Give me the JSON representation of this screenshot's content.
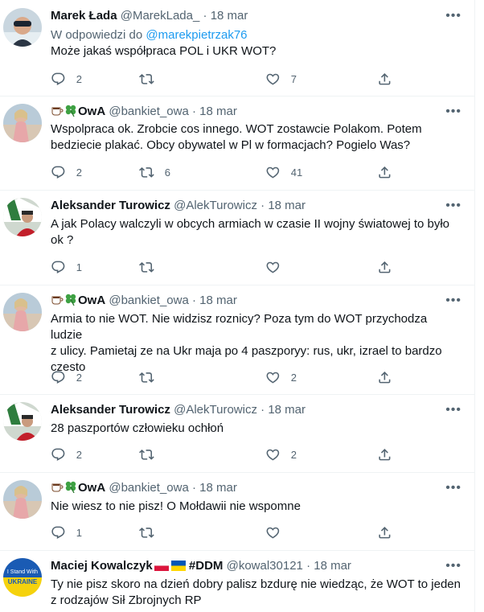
{
  "colors": {
    "link": "#1d9bf0",
    "secondary": "#536471",
    "text": "#0f1419"
  },
  "icons": {
    "reply": "reply-icon",
    "retweet": "retweet-icon",
    "like": "heart-icon",
    "share": "share-icon",
    "more": "more-options-icon"
  },
  "tweets": [
    {
      "name": "Marek Łada",
      "handle": "@MarekLada_",
      "time": "18 mar",
      "reply_prefix": "W odpowiedzi do",
      "reply_to": "@marekpietrzak76",
      "text_lines": [
        "Może jakaś współpraca POL i UKR WOT?"
      ],
      "replies": "2",
      "retweets": "",
      "likes": "7"
    },
    {
      "name": "OwA",
      "handle": "@bankiet_owa",
      "time": "18 mar",
      "text_lines": [
        "Wspolpraca ok. Zrobcie cos innego. WOT zostawcie Polakom. Potem",
        "bedziecie plakać. Obcy obywatel w Pl w formacjach? Pogielo Was?"
      ],
      "replies": "2",
      "retweets": "6",
      "likes": "41"
    },
    {
      "name": "Aleksander Turowicz",
      "handle": "@AlekTurowicz",
      "time": "18 mar",
      "text_lines": [
        "A jak Polacy walczyli w obcych armiach w czasie II wojny światowej to było",
        "ok ?"
      ],
      "replies": "1",
      "retweets": "",
      "likes": ""
    },
    {
      "name": "OwA",
      "handle": "@bankiet_owa",
      "time": "18 mar",
      "text_lines": [
        "Armia to nie WOT. Nie widzisz roznicy? Poza  tym do WOT przychodza ludzie",
        "z ulicy. Pamietaj ze na Ukr maja po 4 paszporyy: rus, ukr, izrael to bardzo",
        "czesto"
      ],
      "replies": "2",
      "retweets": "",
      "likes": "2"
    },
    {
      "name": "Aleksander Turowicz",
      "handle": "@AlekTurowicz",
      "time": "18 mar",
      "text_lines": [
        "28 paszportów człowieku ochłoń"
      ],
      "replies": "2",
      "retweets": "",
      "likes": "2"
    },
    {
      "name": "OwA",
      "handle": "@bankiet_owa",
      "time": "18 mar",
      "text_lines": [
        "Nie wiesz to nie pisz! O Mołdawii nie wspomne"
      ],
      "replies": "1",
      "retweets": "",
      "likes": ""
    },
    {
      "name": "Maciej Kowalczyk",
      "name_suffix": "#DDM",
      "handle": "@kowal30121",
      "time": "18 mar",
      "avatar_text_top": "I Stand With",
      "avatar_text_bottom": "UKRAINE",
      "text_lines": [
        "Ty nie pisz skoro na dzień dobry palisz bzdurę nie wiedząc, że WOT to jeden",
        "z rodzajów Sił Zbrojnych RP"
      ]
    }
  ]
}
